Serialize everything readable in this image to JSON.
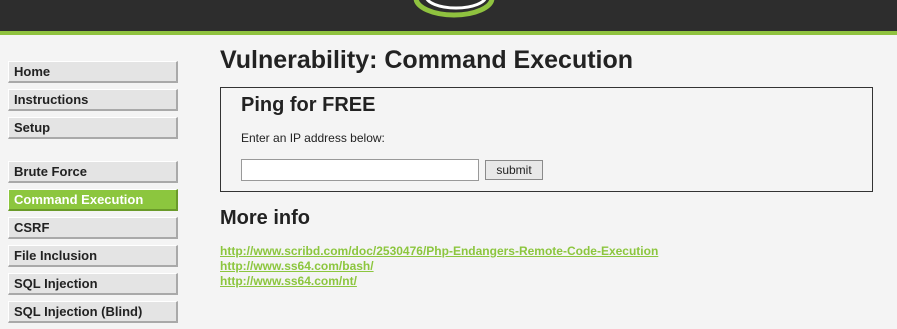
{
  "page": {
    "title": "Vulnerability: Command Execution"
  },
  "sidebar": {
    "groups": [
      [
        "Home",
        "Instructions",
        "Setup"
      ],
      [
        "Brute Force",
        "Command Execution",
        "CSRF",
        "File Inclusion",
        "SQL Injection",
        "SQL Injection (Blind)"
      ]
    ],
    "active": "Command Execution"
  },
  "ping_box": {
    "title": "Ping for FREE",
    "label": "Enter an IP address below:",
    "input_value": "",
    "submit_label": "submit"
  },
  "more_info": {
    "title": "More info",
    "links": [
      "http://www.scribd.com/doc/2530476/Php-Endangers-Remote-Code-Execution",
      "http://www.ss64.com/bash/",
      "http://www.ss64.com/nt/"
    ]
  },
  "colors": {
    "accent": "#8cc63e",
    "header": "#2d2d2d",
    "background": "#f4f4f4"
  }
}
